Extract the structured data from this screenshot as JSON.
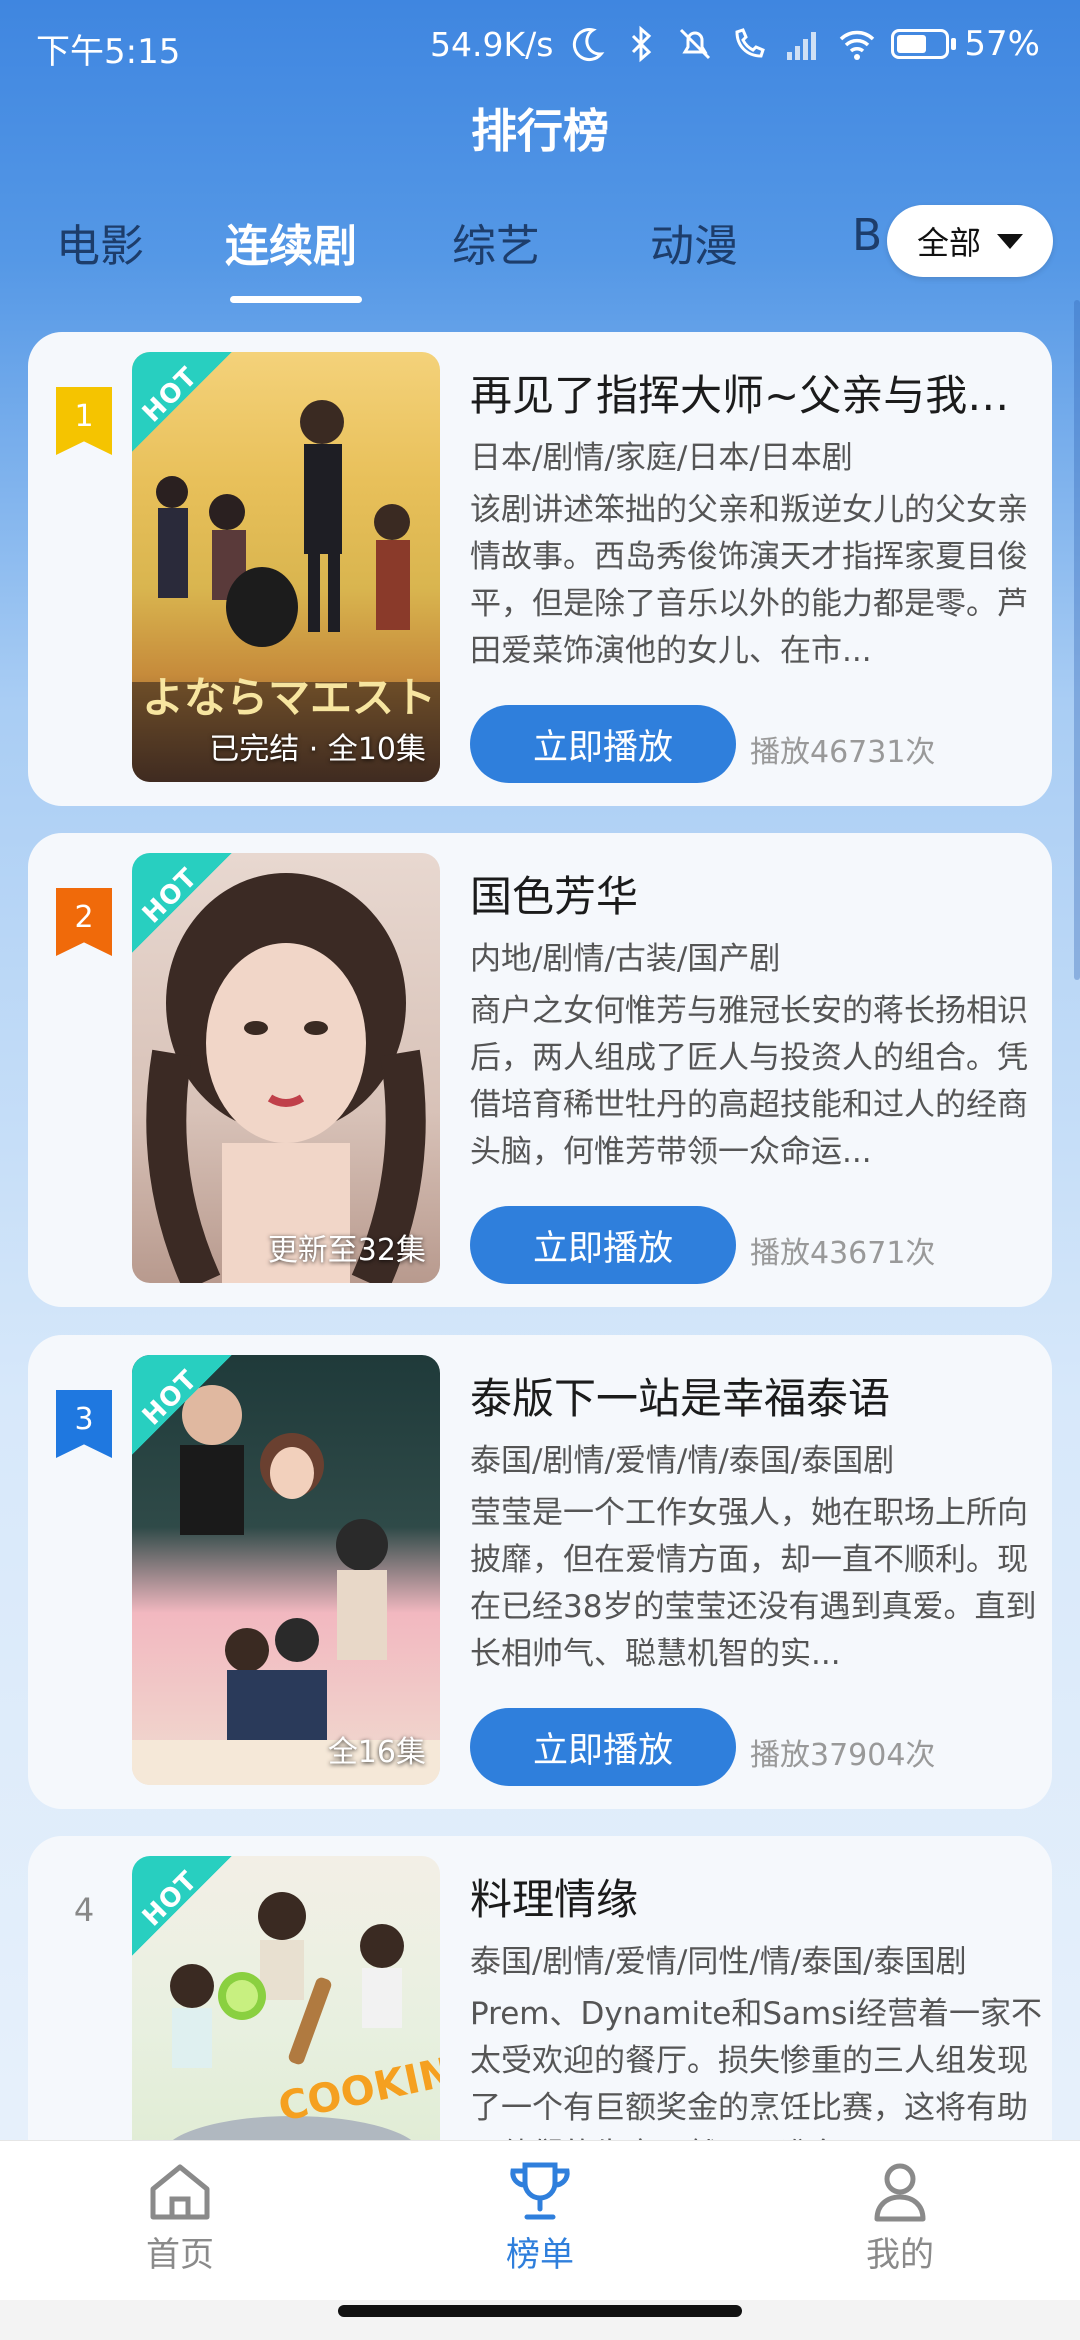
{
  "status_bar": {
    "time": "下午5:15",
    "speed": "54.9K/s",
    "battery": "57%",
    "icons": [
      "moon-icon",
      "bluetooth-icon",
      "mute-icon",
      "call-icon",
      "signal-icon",
      "wifi-icon",
      "battery-icon"
    ]
  },
  "page": {
    "title": "排行榜"
  },
  "tabs": [
    {
      "label": "电影"
    },
    {
      "label": "连续剧"
    },
    {
      "label": "综艺"
    },
    {
      "label": "动漫"
    },
    {
      "label": "B"
    }
  ],
  "active_tab": "连续剧",
  "filter": {
    "label": "全部"
  },
  "items": [
    {
      "rank": "1",
      "rank_color": "#f5c400",
      "hot": "HOT",
      "status": "已完结 · 全10集",
      "title": "再见了指挥大师~父亲与我的...",
      "genre": "日本/剧情/家庭/日本/日本剧",
      "desc": "该剧讲述笨拙的父亲和叛逆女儿的父女亲情故事。西岛秀俊饰演天才指挥家夏目俊平，但是除了音乐以外的能力都是零。芦田爱菜饰演他的女儿、在市...",
      "play_label": "立即播放",
      "plays": "播放46731次"
    },
    {
      "rank": "2",
      "rank_color": "#f06a0a",
      "hot": "HOT",
      "status": "更新至32集",
      "title": "国色芳华",
      "genre": "内地/剧情/古装/国产剧",
      "desc": "商户之女何惟芳与雅冠长安的蒋长扬相识后，两人组成了匠人与投资人的组合。凭借培育稀世牡丹的高超技能和过人的经商头脑，何惟芳带领一众命运...",
      "play_label": "立即播放",
      "plays": "播放43671次"
    },
    {
      "rank": "3",
      "rank_color": "#1f78e0",
      "hot": "HOT",
      "status": "全16集",
      "title": "泰版下一站是幸福泰语",
      "genre": "泰国/剧情/爱情/情/泰国/泰国剧",
      "desc": "莹莹是一个工作女强人，她在职场上所向披靡，但在爱情方面，却一直不顺利。现在已经38岁的莹莹还没有遇到真爱。直到长相帅气、聪慧机智的实...",
      "play_label": "立即播放",
      "plays": "播放37904次"
    },
    {
      "rank": "4",
      "hot": "HOT",
      "title": "料理情缘",
      "genre": "泰国/剧情/爱情/同性/情/泰国/泰国剧",
      "desc": "Prem、Dynamite和Samsi经营着一家不太受欢迎的餐厅。损失惨重的三人组发现了一个有巨额奖金的烹饪比赛，这将有助于他们的生意。然而，准备工..."
    }
  ],
  "nav": [
    {
      "label": "首页",
      "icon": "home-icon"
    },
    {
      "label": "榜单",
      "icon": "trophy-icon"
    },
    {
      "label": "我的",
      "icon": "user-icon"
    }
  ],
  "active_nav": "榜单"
}
